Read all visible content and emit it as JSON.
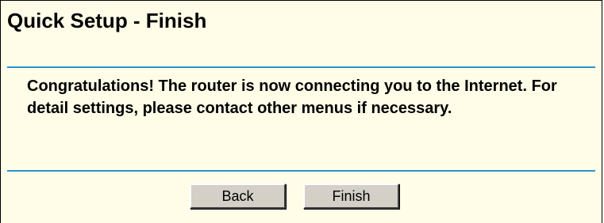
{
  "header": {
    "title": "Quick Setup - Finish"
  },
  "main": {
    "message": "Congratulations! The router is now connecting you to the Internet. For detail settings, please contact other menus if necessary."
  },
  "buttons": {
    "back_label": "Back",
    "finish_label": "Finish"
  },
  "colors": {
    "panel_background": "#fffde8",
    "divider": "#2f8fc9",
    "button_face": "#d4d0c8"
  }
}
